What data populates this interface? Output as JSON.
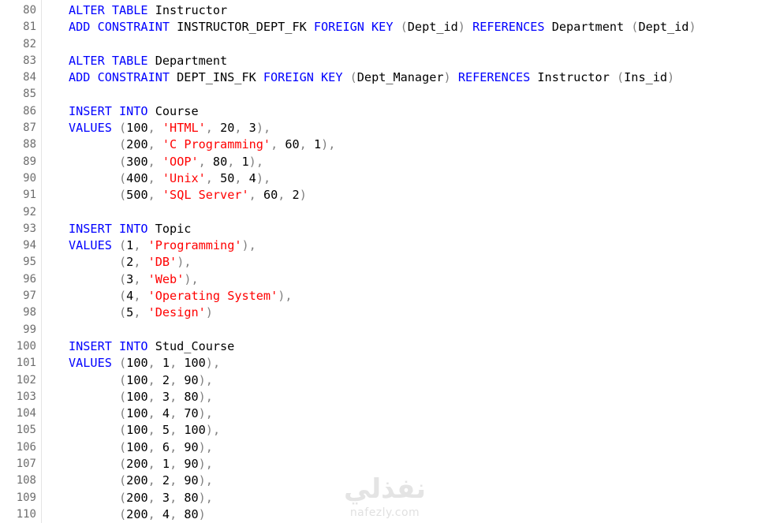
{
  "editor": {
    "lines": [
      {
        "n": "80",
        "tokens": [
          [
            "kw",
            "ALTER TABLE "
          ],
          [
            "txt",
            "Instructor"
          ]
        ]
      },
      {
        "n": "81",
        "tokens": [
          [
            "kw",
            "ADD CONSTRAINT "
          ],
          [
            "txt",
            "INSTRUCTOR_DEPT_FK "
          ],
          [
            "kw",
            "FOREIGN KEY "
          ],
          [
            "pun",
            "("
          ],
          [
            "txt",
            "Dept_id"
          ],
          [
            "pun",
            ") "
          ],
          [
            "kw",
            "REFERENCES "
          ],
          [
            "txt",
            "Department "
          ],
          [
            "pun",
            "("
          ],
          [
            "txt",
            "Dept_id"
          ],
          [
            "pun",
            ")"
          ]
        ]
      },
      {
        "n": "82",
        "tokens": []
      },
      {
        "n": "83",
        "tokens": [
          [
            "kw",
            "ALTER TABLE "
          ],
          [
            "txt",
            "Department"
          ]
        ]
      },
      {
        "n": "84",
        "tokens": [
          [
            "kw",
            "ADD CONSTRAINT "
          ],
          [
            "txt",
            "DEPT_INS_FK "
          ],
          [
            "kw",
            "FOREIGN KEY "
          ],
          [
            "pun",
            "("
          ],
          [
            "txt",
            "Dept_Manager"
          ],
          [
            "pun",
            ") "
          ],
          [
            "kw",
            "REFERENCES "
          ],
          [
            "txt",
            "Instructor "
          ],
          [
            "pun",
            "("
          ],
          [
            "txt",
            "Ins_id"
          ],
          [
            "pun",
            ")"
          ]
        ]
      },
      {
        "n": "85",
        "tokens": []
      },
      {
        "n": "86",
        "tokens": [
          [
            "kw",
            "INSERT INTO "
          ],
          [
            "txt",
            "Course"
          ]
        ]
      },
      {
        "n": "87",
        "tokens": [
          [
            "kw",
            "VALUES "
          ],
          [
            "pun",
            "("
          ],
          [
            "txt",
            "100"
          ],
          [
            "pun",
            ", "
          ],
          [
            "str",
            "'HTML'"
          ],
          [
            "pun",
            ", "
          ],
          [
            "txt",
            "20"
          ],
          [
            "pun",
            ", "
          ],
          [
            "txt",
            "3"
          ],
          [
            "pun",
            "),"
          ]
        ]
      },
      {
        "n": "88",
        "tokens": [
          [
            "txt",
            "       "
          ],
          [
            "pun",
            "("
          ],
          [
            "txt",
            "200"
          ],
          [
            "pun",
            ", "
          ],
          [
            "str",
            "'C Programming'"
          ],
          [
            "pun",
            ", "
          ],
          [
            "txt",
            "60"
          ],
          [
            "pun",
            ", "
          ],
          [
            "txt",
            "1"
          ],
          [
            "pun",
            "),"
          ]
        ]
      },
      {
        "n": "89",
        "tokens": [
          [
            "txt",
            "       "
          ],
          [
            "pun",
            "("
          ],
          [
            "txt",
            "300"
          ],
          [
            "pun",
            ", "
          ],
          [
            "str",
            "'OOP'"
          ],
          [
            "pun",
            ", "
          ],
          [
            "txt",
            "80"
          ],
          [
            "pun",
            ", "
          ],
          [
            "txt",
            "1"
          ],
          [
            "pun",
            "),"
          ]
        ]
      },
      {
        "n": "90",
        "tokens": [
          [
            "txt",
            "       "
          ],
          [
            "pun",
            "("
          ],
          [
            "txt",
            "400"
          ],
          [
            "pun",
            ", "
          ],
          [
            "str",
            "'Unix'"
          ],
          [
            "pun",
            ", "
          ],
          [
            "txt",
            "50"
          ],
          [
            "pun",
            ", "
          ],
          [
            "txt",
            "4"
          ],
          [
            "pun",
            "),"
          ]
        ]
      },
      {
        "n": "91",
        "tokens": [
          [
            "txt",
            "       "
          ],
          [
            "pun",
            "("
          ],
          [
            "txt",
            "500"
          ],
          [
            "pun",
            ", "
          ],
          [
            "str",
            "'SQL Server'"
          ],
          [
            "pun",
            ", "
          ],
          [
            "txt",
            "60"
          ],
          [
            "pun",
            ", "
          ],
          [
            "txt",
            "2"
          ],
          [
            "pun",
            ")"
          ]
        ]
      },
      {
        "n": "92",
        "tokens": []
      },
      {
        "n": "93",
        "tokens": [
          [
            "kw",
            "INSERT INTO "
          ],
          [
            "txt",
            "Topic"
          ]
        ]
      },
      {
        "n": "94",
        "tokens": [
          [
            "kw",
            "VALUES "
          ],
          [
            "pun",
            "("
          ],
          [
            "txt",
            "1"
          ],
          [
            "pun",
            ", "
          ],
          [
            "str",
            "'Programming'"
          ],
          [
            "pun",
            "),"
          ]
        ]
      },
      {
        "n": "95",
        "tokens": [
          [
            "txt",
            "       "
          ],
          [
            "pun",
            "("
          ],
          [
            "txt",
            "2"
          ],
          [
            "pun",
            ", "
          ],
          [
            "str",
            "'DB'"
          ],
          [
            "pun",
            "),"
          ]
        ]
      },
      {
        "n": "96",
        "tokens": [
          [
            "txt",
            "       "
          ],
          [
            "pun",
            "("
          ],
          [
            "txt",
            "3"
          ],
          [
            "pun",
            ", "
          ],
          [
            "str",
            "'Web'"
          ],
          [
            "pun",
            "),"
          ]
        ]
      },
      {
        "n": "97",
        "tokens": [
          [
            "txt",
            "       "
          ],
          [
            "pun",
            "("
          ],
          [
            "txt",
            "4"
          ],
          [
            "pun",
            ", "
          ],
          [
            "str",
            "'Operating System'"
          ],
          [
            "pun",
            "),"
          ]
        ]
      },
      {
        "n": "98",
        "tokens": [
          [
            "txt",
            "       "
          ],
          [
            "pun",
            "("
          ],
          [
            "txt",
            "5"
          ],
          [
            "pun",
            ", "
          ],
          [
            "str",
            "'Design'"
          ],
          [
            "pun",
            ")"
          ]
        ]
      },
      {
        "n": "99",
        "tokens": []
      },
      {
        "n": "100",
        "tokens": [
          [
            "kw",
            "INSERT INTO "
          ],
          [
            "txt",
            "Stud_Course"
          ]
        ]
      },
      {
        "n": "101",
        "tokens": [
          [
            "kw",
            "VALUES "
          ],
          [
            "pun",
            "("
          ],
          [
            "txt",
            "100"
          ],
          [
            "pun",
            ", "
          ],
          [
            "txt",
            "1"
          ],
          [
            "pun",
            ", "
          ],
          [
            "txt",
            "100"
          ],
          [
            "pun",
            "),"
          ]
        ]
      },
      {
        "n": "102",
        "tokens": [
          [
            "txt",
            "       "
          ],
          [
            "pun",
            "("
          ],
          [
            "txt",
            "100"
          ],
          [
            "pun",
            ", "
          ],
          [
            "txt",
            "2"
          ],
          [
            "pun",
            ", "
          ],
          [
            "txt",
            "90"
          ],
          [
            "pun",
            "),"
          ]
        ]
      },
      {
        "n": "103",
        "tokens": [
          [
            "txt",
            "       "
          ],
          [
            "pun",
            "("
          ],
          [
            "txt",
            "100"
          ],
          [
            "pun",
            ", "
          ],
          [
            "txt",
            "3"
          ],
          [
            "pun",
            ", "
          ],
          [
            "txt",
            "80"
          ],
          [
            "pun",
            "),"
          ]
        ]
      },
      {
        "n": "104",
        "tokens": [
          [
            "txt",
            "       "
          ],
          [
            "pun",
            "("
          ],
          [
            "txt",
            "100"
          ],
          [
            "pun",
            ", "
          ],
          [
            "txt",
            "4"
          ],
          [
            "pun",
            ", "
          ],
          [
            "txt",
            "70"
          ],
          [
            "pun",
            "),"
          ]
        ]
      },
      {
        "n": "105",
        "tokens": [
          [
            "txt",
            "       "
          ],
          [
            "pun",
            "("
          ],
          [
            "txt",
            "100"
          ],
          [
            "pun",
            ", "
          ],
          [
            "txt",
            "5"
          ],
          [
            "pun",
            ", "
          ],
          [
            "txt",
            "100"
          ],
          [
            "pun",
            "),"
          ]
        ]
      },
      {
        "n": "106",
        "tokens": [
          [
            "txt",
            "       "
          ],
          [
            "pun",
            "("
          ],
          [
            "txt",
            "100"
          ],
          [
            "pun",
            ", "
          ],
          [
            "txt",
            "6"
          ],
          [
            "pun",
            ", "
          ],
          [
            "txt",
            "90"
          ],
          [
            "pun",
            "),"
          ]
        ]
      },
      {
        "n": "107",
        "tokens": [
          [
            "txt",
            "       "
          ],
          [
            "pun",
            "("
          ],
          [
            "txt",
            "200"
          ],
          [
            "pun",
            ", "
          ],
          [
            "txt",
            "1"
          ],
          [
            "pun",
            ", "
          ],
          [
            "txt",
            "90"
          ],
          [
            "pun",
            "),"
          ]
        ]
      },
      {
        "n": "108",
        "tokens": [
          [
            "txt",
            "       "
          ],
          [
            "pun",
            "("
          ],
          [
            "txt",
            "200"
          ],
          [
            "pun",
            ", "
          ],
          [
            "txt",
            "2"
          ],
          [
            "pun",
            ", "
          ],
          [
            "txt",
            "90"
          ],
          [
            "pun",
            "),"
          ]
        ]
      },
      {
        "n": "109",
        "tokens": [
          [
            "txt",
            "       "
          ],
          [
            "pun",
            "("
          ],
          [
            "txt",
            "200"
          ],
          [
            "pun",
            ", "
          ],
          [
            "txt",
            "3"
          ],
          [
            "pun",
            ", "
          ],
          [
            "txt",
            "80"
          ],
          [
            "pun",
            "),"
          ]
        ]
      },
      {
        "n": "110",
        "tokens": [
          [
            "txt",
            "       "
          ],
          [
            "pun",
            "("
          ],
          [
            "txt",
            "200"
          ],
          [
            "pun",
            ", "
          ],
          [
            "txt",
            "4"
          ],
          [
            "pun",
            ", "
          ],
          [
            "txt",
            "80"
          ],
          [
            "pun",
            ")"
          ]
        ]
      }
    ]
  },
  "colors": {
    "keyword": "#0000ff",
    "string": "#ff0000",
    "punctuation": "#808080",
    "text": "#000000",
    "line_number": "#6e6e6e"
  },
  "watermark": {
    "arabic": "نفذلي",
    "latin": "nafezly.com"
  }
}
